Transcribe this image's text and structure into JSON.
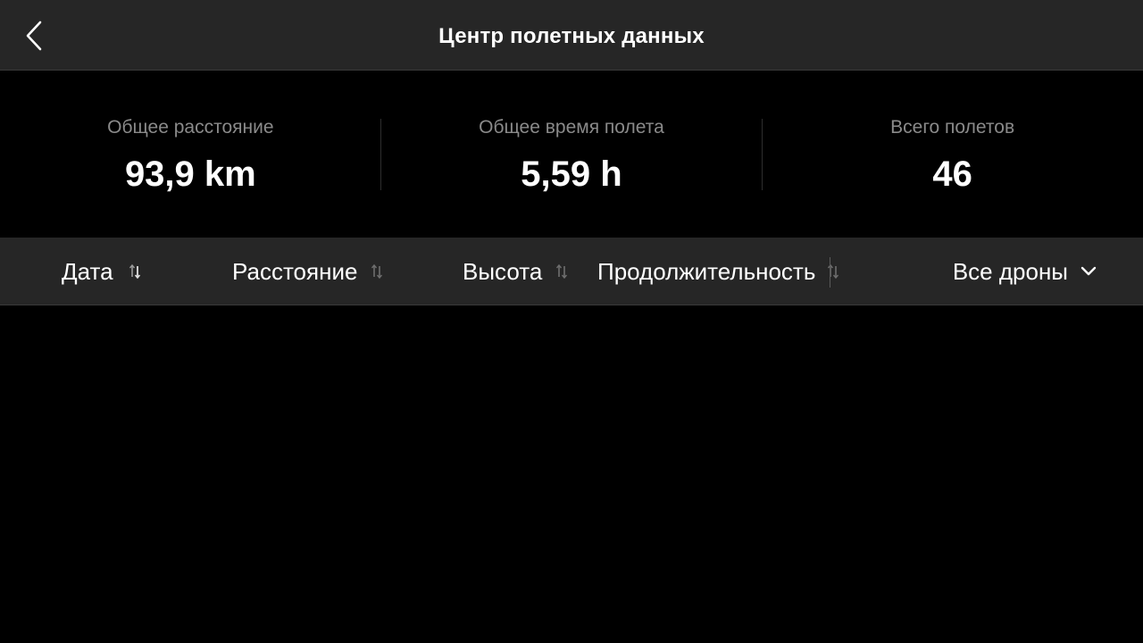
{
  "header": {
    "title": "Центр полетных данных",
    "back_icon": "chevron-left-icon"
  },
  "stats": [
    {
      "label": "Общее расстояние",
      "value": "93,9 km"
    },
    {
      "label": "Общее время полета",
      "value": "5,59 h"
    },
    {
      "label": "Всего полетов",
      "value": "46"
    }
  ],
  "sort_bar": {
    "date_label": "Дата",
    "distance_label": "Расстояние",
    "altitude_label": "Высота",
    "duration_label": "Продолжительность",
    "sort_icon": "sort-arrows-icon",
    "drone_filter": {
      "selected": "Все дроны",
      "icon": "chevron-down-icon"
    }
  },
  "flights": [],
  "colors": {
    "header_bg": "#262626",
    "page_bg": "#000000",
    "label_gray": "#8a8a8a",
    "text": "#ffffff",
    "sort_icon_inactive": "#6e6e6e",
    "sort_icon_active": "#d0d0d0"
  }
}
